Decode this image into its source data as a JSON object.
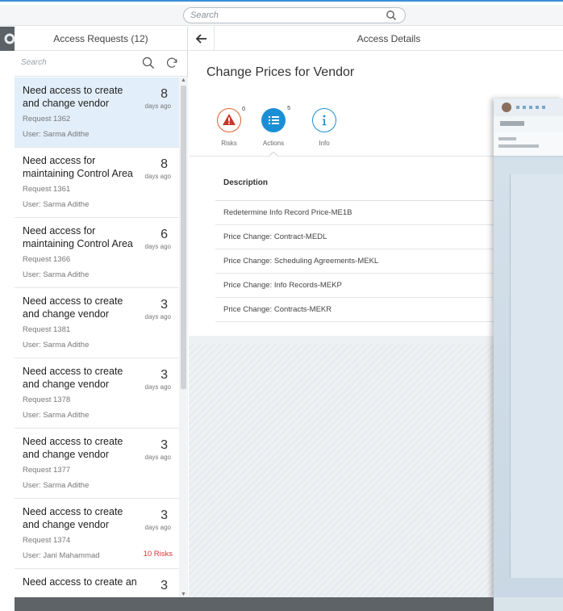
{
  "topbar": {
    "search_placeholder": "Search"
  },
  "master": {
    "title": "Access Requests (12)",
    "search_placeholder": "Search",
    "items": [
      {
        "title": "Need access to create and change vendor",
        "count": "8",
        "ago": "days ago",
        "request": "Request 1362",
        "user": "User: Sarma Adithe",
        "risks": ""
      },
      {
        "title": "Need access for maintaining Control Area",
        "count": "8",
        "ago": "days ago",
        "request": "Request 1361",
        "user": "User: Sarma Adithe",
        "risks": ""
      },
      {
        "title": "Need access for maintaining Control Area",
        "count": "6",
        "ago": "days ago",
        "request": "Request 1366",
        "user": "User: Sarma Adithe",
        "risks": ""
      },
      {
        "title": "Need access to create and change vendor",
        "count": "3",
        "ago": "days ago",
        "request": "Request 1381",
        "user": "User: Sarma Adithe",
        "risks": ""
      },
      {
        "title": "Need access to create and change vendor",
        "count": "3",
        "ago": "days ago",
        "request": "Request 1378",
        "user": "User: Sarma Adithe",
        "risks": ""
      },
      {
        "title": "Need access to create and change vendor",
        "count": "3",
        "ago": "days ago",
        "request": "Request 1377",
        "user": "User: Sarma Adithe",
        "risks": ""
      },
      {
        "title": "Need access to create and change vendor",
        "count": "3",
        "ago": "days ago",
        "request": "Request 1374",
        "user": "User: Jani Mahammad",
        "risks": "10 Risks"
      },
      {
        "title": "Need access to create an",
        "count": "3",
        "ago": "",
        "request": "",
        "user": "",
        "risks": ""
      }
    ]
  },
  "detail": {
    "header_title": "Access Details",
    "object_title": "Change Prices for Vendor",
    "tabs": [
      {
        "label": "Risks",
        "count": "0",
        "icon": "warning-icon",
        "color": "#e0612b"
      },
      {
        "label": "Actions",
        "count": "5",
        "icon": "list-icon",
        "color": "#1b8fd6"
      },
      {
        "label": "Info",
        "count": "",
        "icon": "info-icon",
        "color": "#1b8fd6"
      }
    ],
    "table": {
      "header": "Description",
      "rows": [
        "Redetermine Info Record Price-ME1B",
        "Price Change: Contract-MEDL",
        "Price Change: Scheduling Agreements-MEKL",
        "Price Change: Info Records-MEKP",
        "Price Change: Contracts-MEKR"
      ]
    }
  }
}
